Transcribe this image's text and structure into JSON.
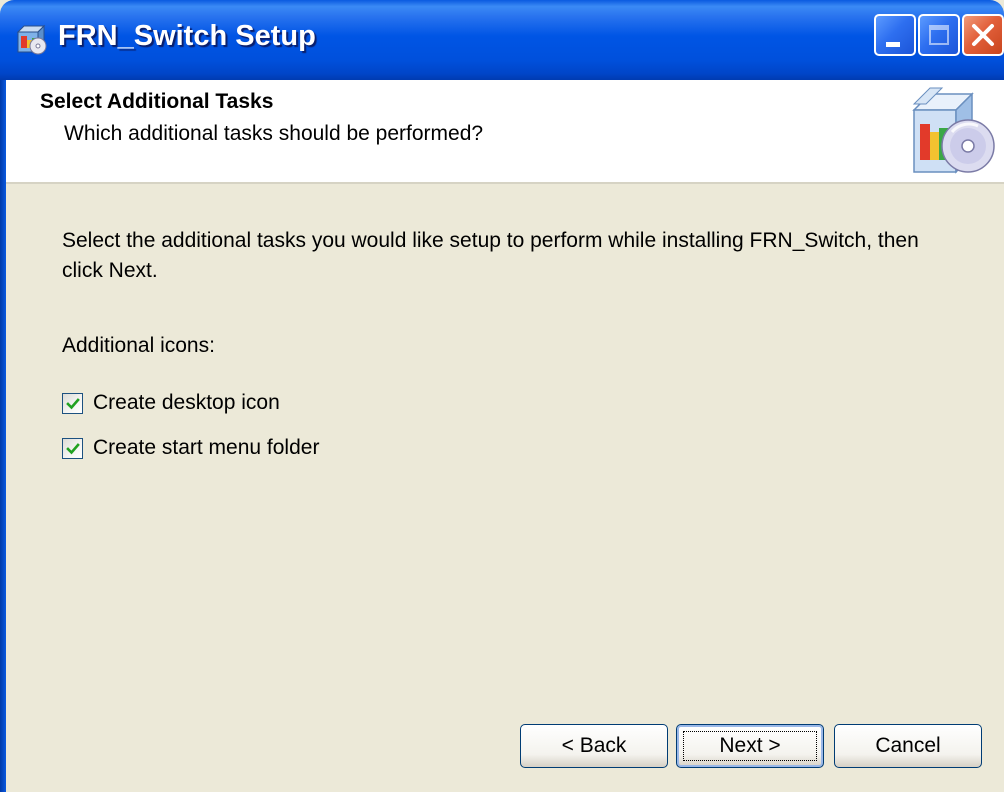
{
  "window": {
    "title": "FRN_Switch Setup"
  },
  "header": {
    "title": "Select Additional Tasks",
    "subtitle": "Which additional tasks should be performed?"
  },
  "body": {
    "instructions": "Select the additional tasks you would like setup to perform while installing FRN_Switch, then click Next.",
    "icons_group_label": "Additional icons:",
    "tasks": [
      {
        "label": "Create desktop icon",
        "checked": true
      },
      {
        "label": "Create start menu folder",
        "checked": true
      }
    ]
  },
  "buttons": {
    "back": "< Back",
    "next": "Next >",
    "cancel": "Cancel"
  },
  "icons": {
    "app": "setup-installer-icon",
    "header": "software-box-cd-icon",
    "minimize": "minimize-icon",
    "maximize": "maximize-icon",
    "close": "close-icon"
  },
  "colors": {
    "titlebar": "#0055e5",
    "close_button": "#e2603b",
    "dialog_background": "#ece9d8",
    "header_background": "#ffffff"
  }
}
